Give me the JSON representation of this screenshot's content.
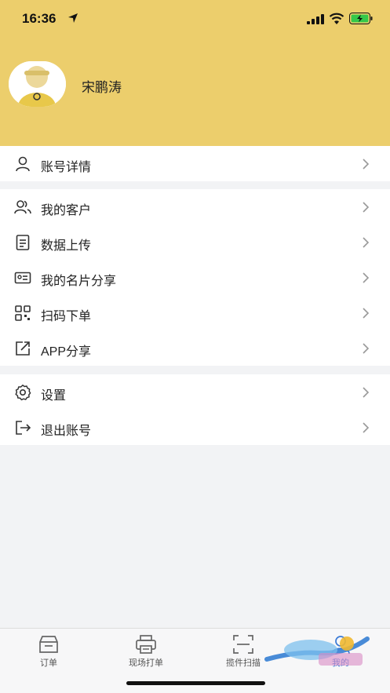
{
  "status_bar": {
    "time": "16:36"
  },
  "profile": {
    "name": "宋鹏涛"
  },
  "menu": {
    "group1": [
      {
        "label": "账号详情",
        "icon": "user-icon"
      }
    ],
    "group2": [
      {
        "label": "我的客户",
        "icon": "customers-icon"
      },
      {
        "label": "数据上传",
        "icon": "document-icon"
      },
      {
        "label": "我的名片分享",
        "icon": "card-icon"
      },
      {
        "label": "扫码下单",
        "icon": "qr-icon"
      },
      {
        "label": "APP分享",
        "icon": "share-icon"
      }
    ],
    "group3": [
      {
        "label": "设置",
        "icon": "gear-icon"
      },
      {
        "label": "退出账号",
        "icon": "logout-icon"
      }
    ]
  },
  "tabbar": [
    {
      "label": "订单",
      "icon": "inbox-icon"
    },
    {
      "label": "现场打单",
      "icon": "printer-icon"
    },
    {
      "label": "揽件扫描",
      "icon": "scan-icon"
    },
    {
      "label": "我的",
      "icon": "profile-icon",
      "active": true
    }
  ],
  "colors": {
    "header": "#ecce6c",
    "active_tab": "#3b7bd6"
  }
}
